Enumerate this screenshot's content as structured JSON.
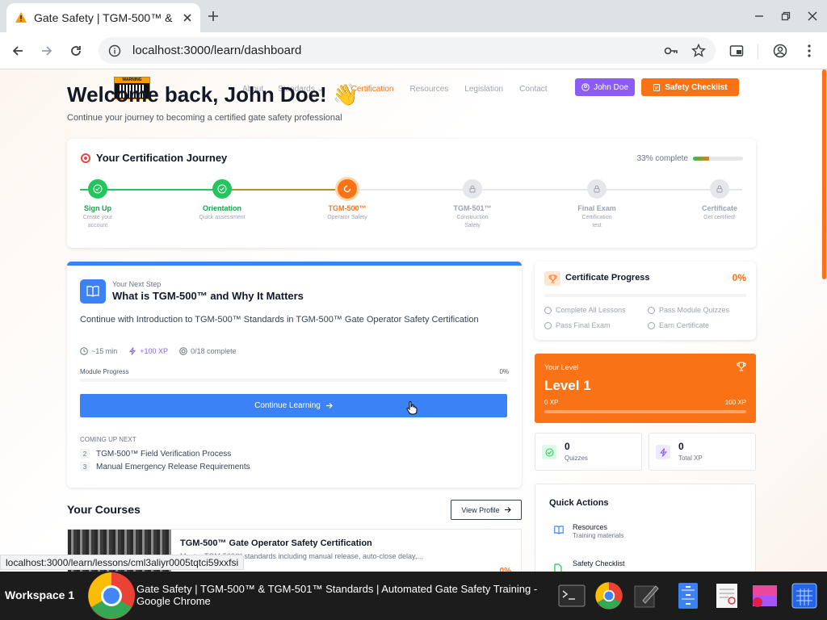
{
  "browser": {
    "tab_title": "Gate Safety | TGM-500™ &",
    "url": "localhost:3000/learn/dashboard",
    "status_url": "localhost:3000/learn/lessons/cml3aliyr0005tqtci59xxfsi"
  },
  "site_nav": {
    "logo_text": "WARNING",
    "items": [
      "About",
      "Standards",
      "Certification",
      "Resources",
      "Legislation",
      "Contact"
    ],
    "user_button": "John Doe",
    "checklist_button": "Safety Checklist"
  },
  "hero": {
    "title": "Welcome back, John Doe! 👋",
    "subtitle": "Continue your journey to becoming a certified gate safety professional"
  },
  "journey": {
    "title": "Your Certification Journey",
    "percent_text": "33% complete",
    "percent": 33,
    "steps": [
      {
        "label": "Sign Up",
        "desc": "Create your account",
        "state": "done"
      },
      {
        "label": "Orientation",
        "desc": "Quick assessment",
        "state": "done"
      },
      {
        "label": "TGM-500™",
        "desc": "Operator Safety",
        "state": "current"
      },
      {
        "label": "TGM-501™",
        "desc": "Construction Safety",
        "state": "locked"
      },
      {
        "label": "Final Exam",
        "desc": "Certification test",
        "state": "locked"
      },
      {
        "label": "Certificate",
        "desc": "Get certified!",
        "state": "locked"
      }
    ]
  },
  "next_step": {
    "label": "Your Next Step",
    "title": "What is TGM-500™ and Why It Matters",
    "description": "Continue with Introduction to TGM-500™ Standards in TGM-500™ Gate Operator Safety Certification",
    "duration": "~15 min",
    "xp": "+100 XP",
    "complete": "0/18 complete",
    "module_progress_label": "Module Progress",
    "module_progress_pct": "0%",
    "button": "Continue Learning",
    "coming_up_label": "COMING UP NEXT",
    "coming_up": [
      {
        "n": "2",
        "title": "TGM-500™ Field Verification Process"
      },
      {
        "n": "3",
        "title": "Manual Emergency Release Requirements"
      }
    ]
  },
  "certificate_progress": {
    "title": "Certificate Progress",
    "pct": "0%",
    "requirements": [
      "Complete All Lessons",
      "Pass Module Quizzes",
      "Pass Final Exam",
      "Earn Certificate"
    ]
  },
  "level": {
    "label": "Your Level",
    "value": "Level 1",
    "xp_min": "0 XP",
    "xp_max": "100 XP"
  },
  "stats": [
    {
      "value": "0",
      "label": "Quizzes"
    },
    {
      "value": "0",
      "label": "Total XP"
    }
  ],
  "quick_actions": {
    "title": "Quick Actions",
    "items": [
      {
        "title": "Resources",
        "sub": "Training materials"
      },
      {
        "title": "Safety Checklist",
        "sub": ""
      }
    ]
  },
  "courses": {
    "title": "Your Courses",
    "view_profile": "View Profile",
    "items": [
      {
        "title": "TGM-500™ Gate Operator Safety Certification",
        "desc": "Master TGM-500™ standards including manual release, auto-close delay,...",
        "pct": "0%"
      }
    ]
  },
  "taskbar": {
    "workspace": "Workspace 1",
    "window_title": "Gate Safety | TGM-500™ & TGM-501™ Standards | Automated Gate Safety Training - Google Chrome"
  },
  "colors": {
    "accent": "#f97316",
    "primary": "#3b82f6",
    "success": "#22c55e",
    "purple": "#8b5cf6"
  }
}
